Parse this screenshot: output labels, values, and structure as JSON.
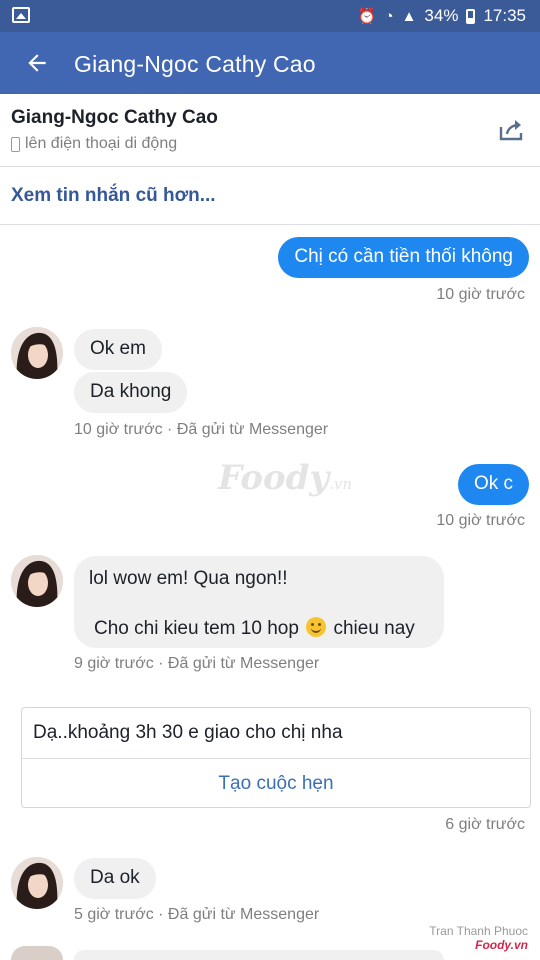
{
  "status_bar": {
    "battery": "34%",
    "time": "17:35"
  },
  "app_bar": {
    "title": "Giang-Ngoc Cathy Cao"
  },
  "contact": {
    "name": "Giang-Ngoc Cathy Cao",
    "subtitle": "lên điện thoại di động"
  },
  "older_messages_label": "Xem tin nhắn cũ hơn...",
  "messages": [
    {
      "direction": "out",
      "text": "Chị có cần tiền thối không",
      "meta": "10 giờ trước"
    },
    {
      "direction": "in",
      "texts": [
        "Ok em",
        "Da khong"
      ],
      "meta": "10 giờ trước · Đã gửi từ Messenger"
    },
    {
      "direction": "out",
      "text": "Ok c",
      "meta": "10 giờ trước"
    },
    {
      "direction": "in",
      "line1": "lol wow em! Qua ngon!!",
      "line2_a": "Cho chi kieu tem 10 hop",
      "line2_b": "chieu nay",
      "meta": "9 giờ trước · Đã gửi từ Messenger"
    },
    {
      "direction": "out",
      "card_text": "Dạ..khoảng 3h 30 e giao cho chị nha",
      "card_button": "Tạo cuộc hẹn",
      "meta": "6 giờ trước"
    },
    {
      "direction": "in",
      "text": "Da ok",
      "meta": "5 giờ trước · Đã gửi từ Messenger"
    }
  ],
  "watermark": {
    "brand": "Foody",
    "suffix": ".vn"
  },
  "credit": {
    "author": "Tran Thanh Phuoc",
    "brand": "Foody.vn"
  },
  "colors": {
    "app_bar": "#4267b2",
    "status_bar": "#3a5a98",
    "outgoing_bubble": "#1e88f0",
    "incoming_bubble": "#f0f0f0",
    "link": "#365899"
  },
  "icons": {
    "back": "arrow-left-icon",
    "share": "share-icon",
    "phone": "mobile-phone-icon",
    "gallery": "image-icon"
  }
}
